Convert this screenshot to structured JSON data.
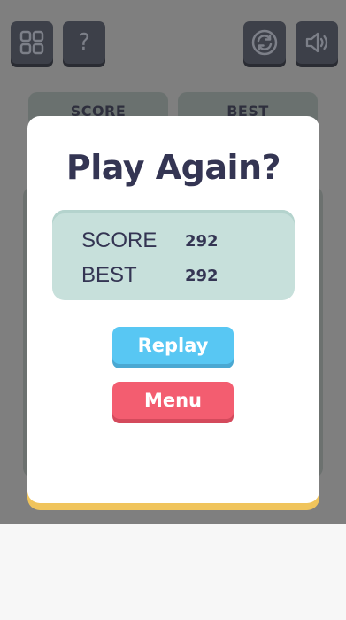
{
  "toolbar": {
    "left": [
      "grid-icon",
      "help-icon"
    ],
    "right": [
      "restart-icon",
      "sound-icon"
    ],
    "help_glyph": "?"
  },
  "background_tabs": {
    "score_label": "SCORE",
    "best_label": "BEST"
  },
  "modal": {
    "title": "Play Again?",
    "score_label": "SCORE",
    "score_value": "292",
    "best_label": "BEST",
    "best_value": "292",
    "replay_label": "Replay",
    "menu_label": "Menu"
  },
  "colors": {
    "dim_overlay": "#7f7f7f",
    "icon_button": "#3d4049",
    "modal_bg": "#ffffff",
    "modal_accent": "#f0c45c",
    "panel_bg": "#c7e0db",
    "text_dark": "#343553",
    "replay": "#58c7f3",
    "menu": "#f35d70"
  }
}
